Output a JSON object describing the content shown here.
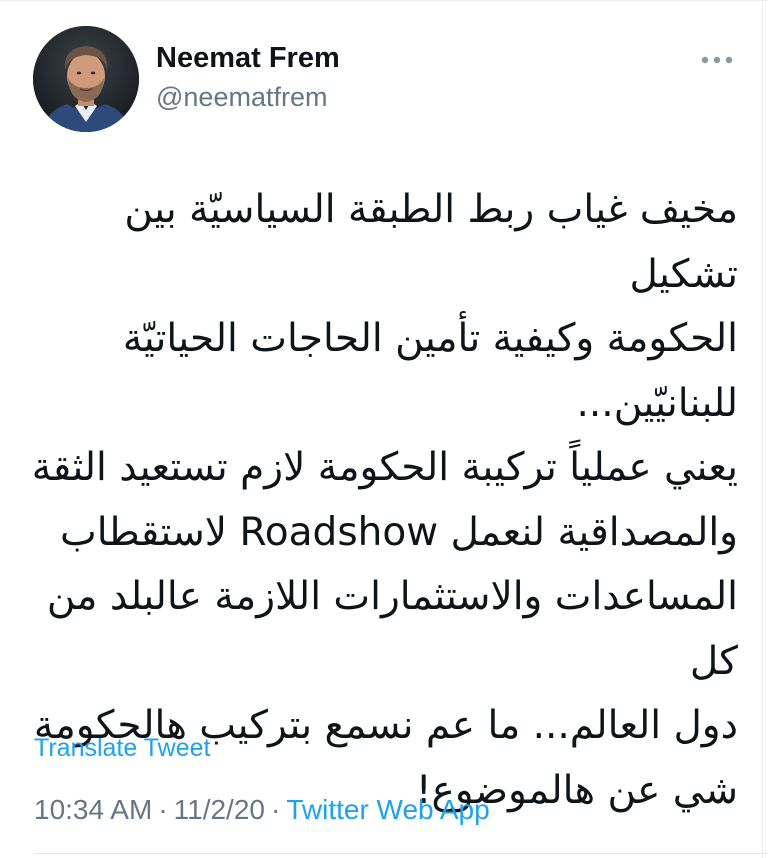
{
  "tweet": {
    "author": {
      "display_name": "Neemat Frem",
      "handle": "@neematfrem",
      "avatar_icon": "profile-photo"
    },
    "more_icon": "ellipsis-icon",
    "text": "مخيف غياب ربط الطبقة السياسيّة بين تشكيل\nالحكومة وكيفية تأمين الحاجات الحياتيّة\nللبنانيّين...\nيعني عملياً تركيبة الحكومة لازم تستعيد الثقة\nوالمصداقية لنعمل Roadshow لاستقطاب\nالمساعدات والاستثمارات اللازمة عالبلد من كل\nدول العالم... ما عم نسمع بتركيب هالحكومة\nشي عن هالموضوع!",
    "translate_label": "Translate Tweet",
    "time": "10:34 AM",
    "date": "11/2/20",
    "separator": "·",
    "source": "Twitter Web App"
  },
  "colors": {
    "link": "#1da1f2",
    "secondary_text": "#657786",
    "primary_text": "#0f1419"
  }
}
